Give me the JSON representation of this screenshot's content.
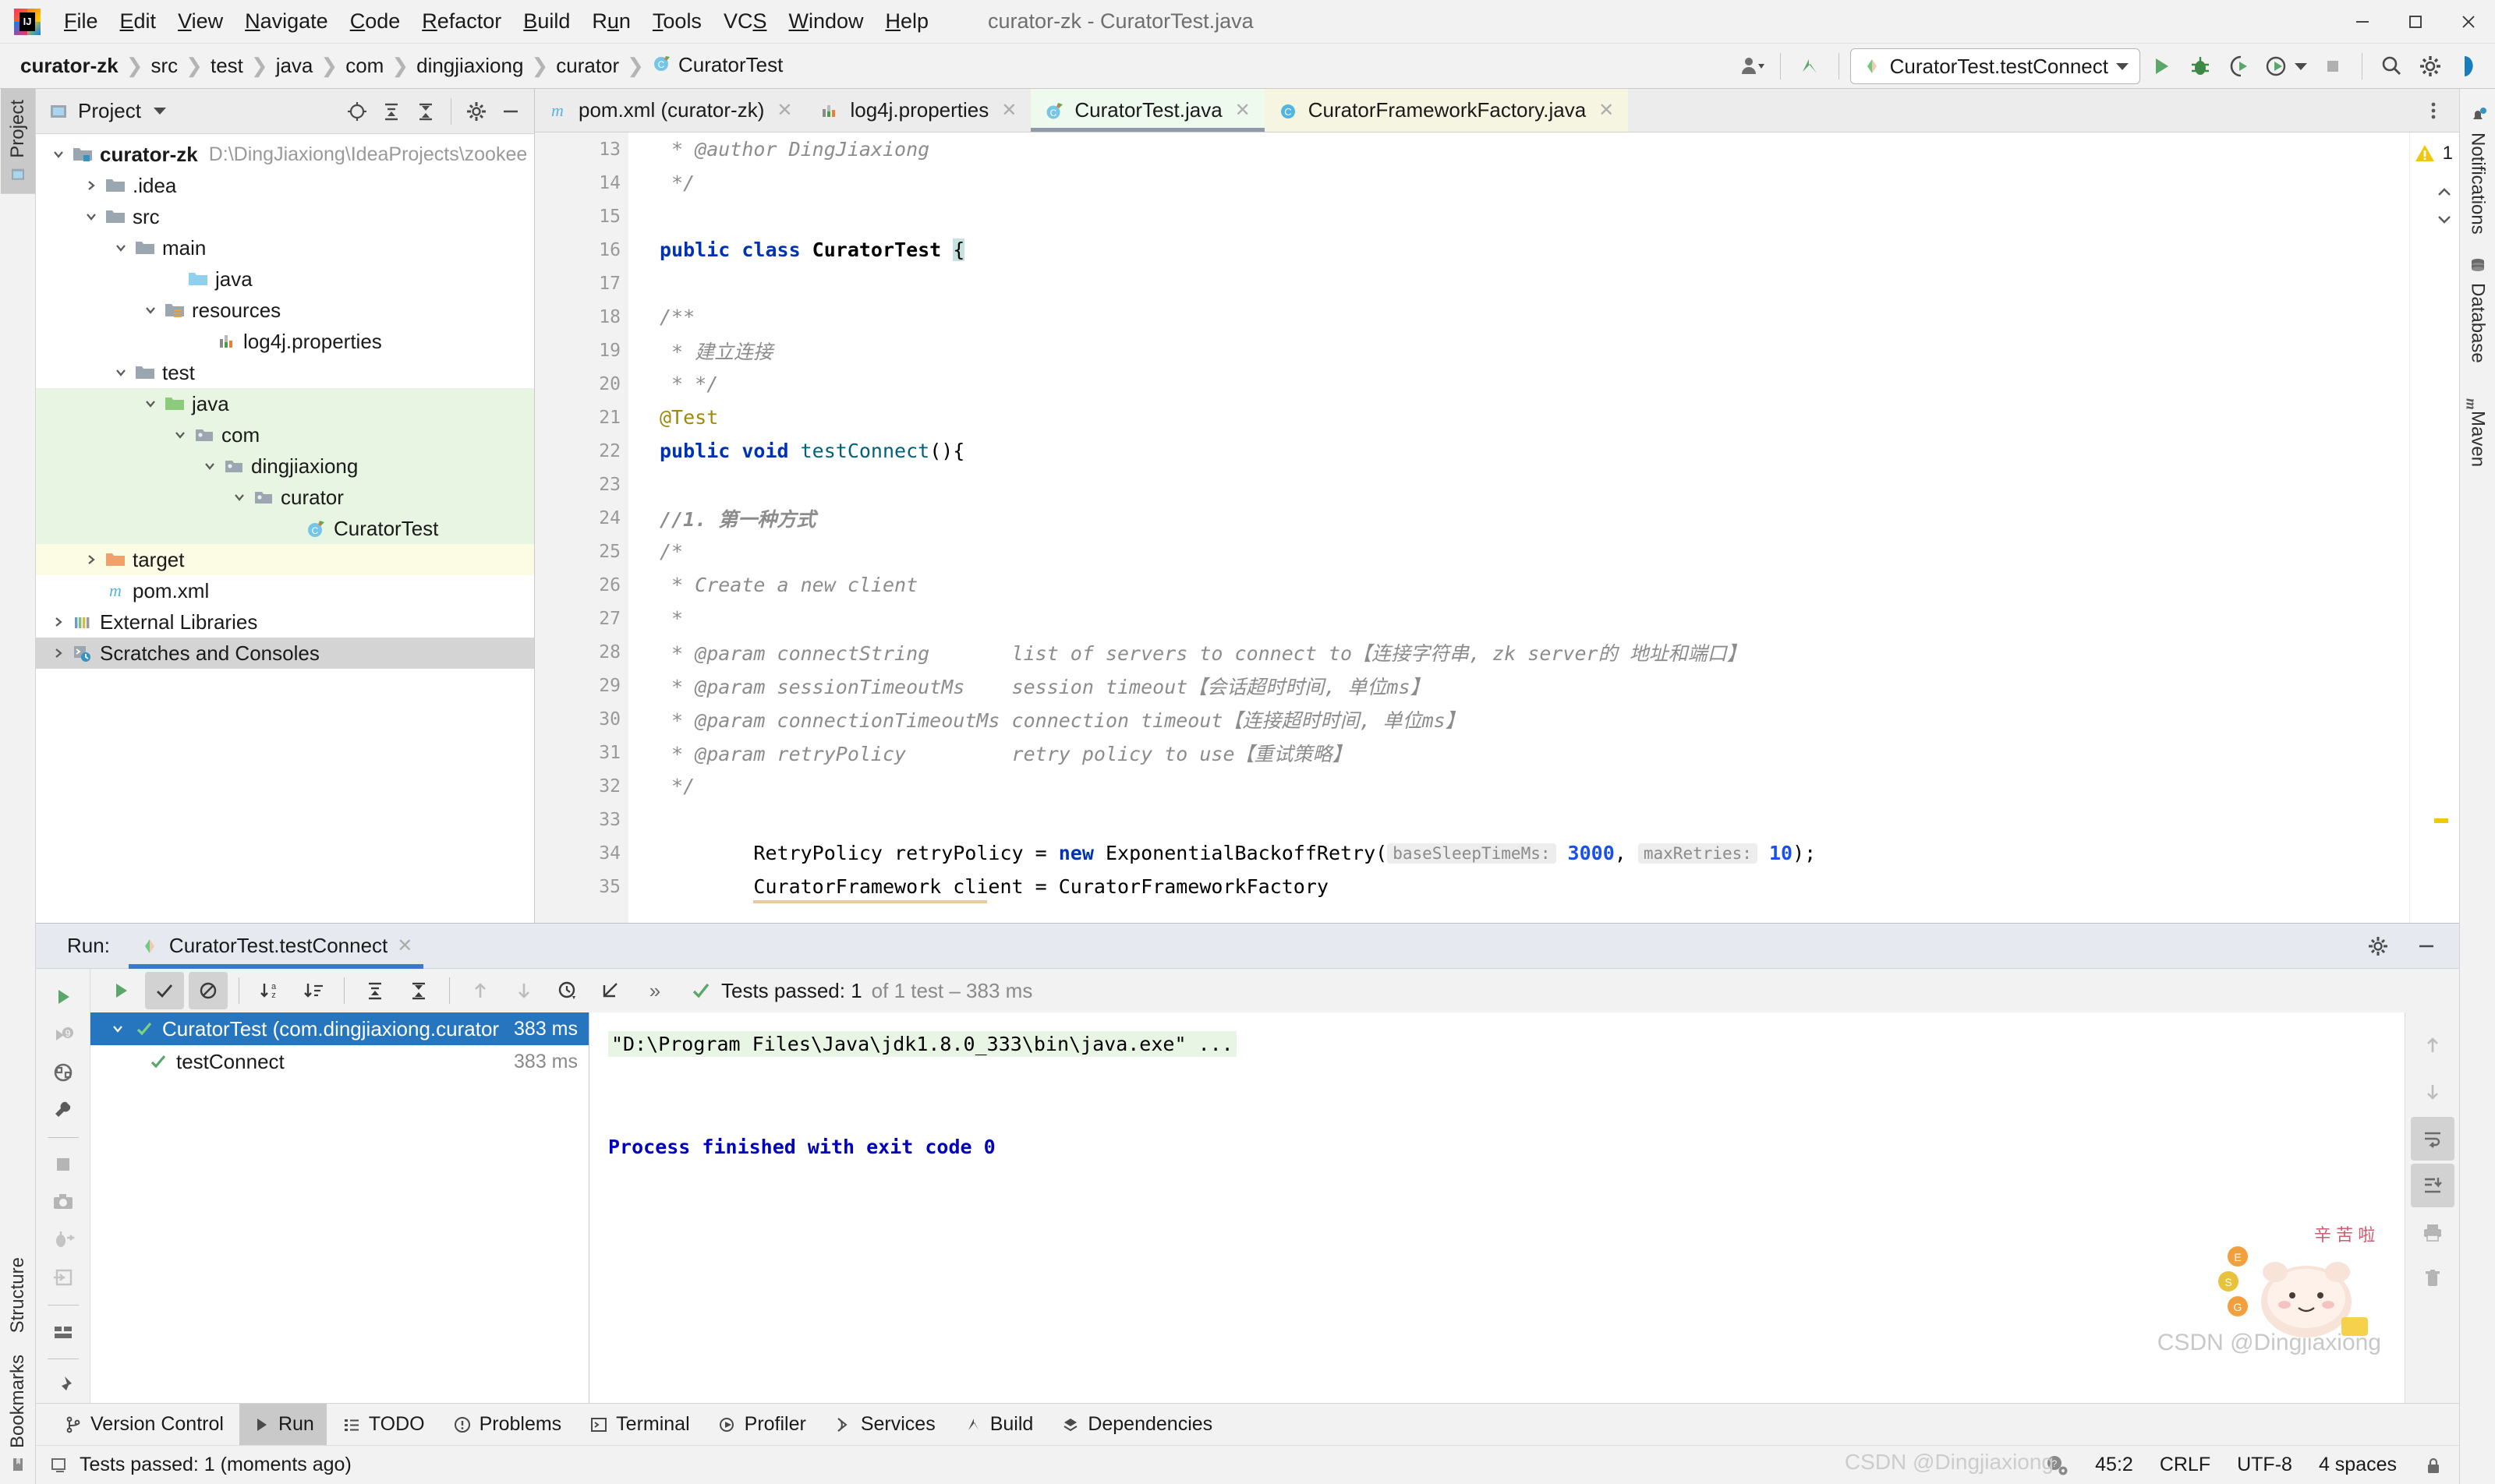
{
  "window": {
    "title": "curator-zk - CuratorTest.java",
    "controls": {
      "minimize": "minimize-icon",
      "maximize": "maximize-icon",
      "close": "close-icon"
    }
  },
  "menu": {
    "items": [
      {
        "label": "File",
        "accel": "F"
      },
      {
        "label": "Edit",
        "accel": "E"
      },
      {
        "label": "View",
        "accel": "V"
      },
      {
        "label": "Navigate",
        "accel": "N"
      },
      {
        "label": "Code",
        "accel": "C"
      },
      {
        "label": "Refactor",
        "accel": "R"
      },
      {
        "label": "Build",
        "accel": "B"
      },
      {
        "label": "Run",
        "accel": "u"
      },
      {
        "label": "Tools",
        "accel": "T"
      },
      {
        "label": "VCS",
        "accel": "S"
      },
      {
        "label": "Window",
        "accel": "W"
      },
      {
        "label": "Help",
        "accel": "H"
      }
    ]
  },
  "navbar": {
    "breadcrumbs": [
      "curator-zk",
      "src",
      "test",
      "java",
      "com",
      "dingjiaxiong",
      "curator",
      "CuratorTest"
    ],
    "run_config": "CuratorTest.testConnect",
    "buttons": [
      "user-icon",
      "updates-icon",
      "run-button",
      "debug-button",
      "run-with-coverage-button",
      "profiler-button",
      "stop-button",
      "search-button",
      "settings-button"
    ]
  },
  "left_strip": {
    "items": [
      "Project",
      "Structure",
      "Bookmarks"
    ],
    "active": "Project"
  },
  "right_strip": {
    "items": [
      "Notifications",
      "Database",
      "Maven"
    ]
  },
  "project_tool_window": {
    "title": "Project",
    "header_icons": [
      "locate-icon",
      "expand-all-icon",
      "collapse-all-icon",
      "settings-icon",
      "hide-icon"
    ],
    "tree": [
      {
        "label": "curator-zk",
        "path": "D:\\DingJiaxiong\\IdeaProjects\\zookee",
        "depth": 0,
        "arrow": "down",
        "icon": "module-folder",
        "bold": true,
        "bg": "none"
      },
      {
        "label": ".idea",
        "depth": 1,
        "arrow": "right",
        "icon": "folder-grey",
        "bg": "none"
      },
      {
        "label": "src",
        "depth": 1,
        "arrow": "down",
        "icon": "folder-grey",
        "bg": "none"
      },
      {
        "label": "main",
        "depth": 2,
        "arrow": "down",
        "icon": "folder-grey",
        "bg": "none"
      },
      {
        "label": "java",
        "depth": 3,
        "arrow": "none",
        "icon": "folder-blue",
        "bg": "none"
      },
      {
        "label": "resources",
        "depth": 3,
        "arrow": "down",
        "icon": "folder-resources",
        "bg": "none"
      },
      {
        "label": "log4j.properties",
        "depth": 4,
        "arrow": "none",
        "icon": "properties-file",
        "bg": "none"
      },
      {
        "label": "test",
        "depth": 2,
        "arrow": "down",
        "icon": "folder-grey",
        "bg": "none"
      },
      {
        "label": "java",
        "depth": 3,
        "arrow": "down",
        "icon": "folder-green",
        "bg": "green"
      },
      {
        "label": "com",
        "depth": 4,
        "arrow": "down",
        "icon": "package",
        "bg": "green"
      },
      {
        "label": "dingjiaxiong",
        "depth": 5,
        "arrow": "down",
        "icon": "package",
        "bg": "green"
      },
      {
        "label": "curator",
        "depth": 6,
        "arrow": "down",
        "icon": "package",
        "bg": "green"
      },
      {
        "label": "CuratorTest",
        "depth": 7,
        "arrow": "none",
        "icon": "test-class",
        "bg": "green"
      },
      {
        "label": "target",
        "depth": 1,
        "arrow": "right",
        "icon": "folder-orange",
        "bg": "yellow"
      },
      {
        "label": "pom.xml",
        "depth": 1,
        "arrow": "none",
        "icon": "maven-file",
        "bg": "none"
      },
      {
        "label": "External Libraries",
        "depth": 0,
        "arrow": "right",
        "icon": "libraries",
        "bg": "none"
      },
      {
        "label": "Scratches and Consoles",
        "depth": 0,
        "arrow": "right",
        "icon": "scratches",
        "bg": "grey"
      }
    ]
  },
  "editor": {
    "tabs": [
      {
        "label": "pom.xml (curator-zk)",
        "icon": "maven-file",
        "state": "inactive"
      },
      {
        "label": "log4j.properties",
        "icon": "properties-file",
        "state": "inactive"
      },
      {
        "label": "CuratorTest.java",
        "icon": "test-class",
        "state": "active-green"
      },
      {
        "label": "CuratorFrameworkFactory.java",
        "icon": "java-class",
        "state": "active-yellow"
      }
    ],
    "warning_count": "1",
    "lines": [
      {
        "n": "13",
        "indent": 0,
        "segments": [
          {
            "t": "cmt",
            "v": " * @author DingJiaxiong"
          }
        ]
      },
      {
        "n": "14",
        "indent": 0,
        "fold": "end",
        "segments": [
          {
            "t": "cmt",
            "v": " */"
          }
        ]
      },
      {
        "n": "15",
        "indent": 0,
        "segments": []
      },
      {
        "n": "16",
        "indent": 0,
        "gmark": "run-test-gutter",
        "segments": [
          {
            "t": "kw",
            "v": "public class "
          },
          {
            "t": "cls",
            "v": "CuratorTest "
          },
          {
            "t": "cursor",
            "v": "{"
          }
        ]
      },
      {
        "n": "17",
        "indent": 0,
        "segments": []
      },
      {
        "n": "18",
        "indent": 1,
        "fold": "start",
        "segments": [
          {
            "t": "cmt",
            "v": "/**"
          }
        ]
      },
      {
        "n": "19",
        "indent": 1,
        "segments": [
          {
            "t": "cmt",
            "v": " * 建立连接"
          }
        ]
      },
      {
        "n": "20",
        "indent": 1,
        "fold": "end",
        "segments": [
          {
            "t": "cmt",
            "v": " * */"
          }
        ]
      },
      {
        "n": "21",
        "indent": 1,
        "segments": [
          {
            "t": "ann",
            "v": "@Test"
          }
        ]
      },
      {
        "n": "22",
        "indent": 1,
        "gmark": "run-test-gutter",
        "fold": "start",
        "segments": [
          {
            "t": "kw",
            "v": "public void "
          },
          {
            "t": "fn",
            "v": "testConnect"
          },
          {
            "t": "plain",
            "v": "(){"
          }
        ]
      },
      {
        "n": "23",
        "indent": 1,
        "segments": []
      },
      {
        "n": "24",
        "indent": 2,
        "segments": [
          {
            "t": "cmt-b",
            "v": "//1. 第一种方式"
          }
        ]
      },
      {
        "n": "25",
        "indent": 2,
        "fold": "start",
        "segments": [
          {
            "t": "cmt",
            "v": "/*"
          }
        ]
      },
      {
        "n": "26",
        "indent": 2,
        "segments": [
          {
            "t": "cmt",
            "v": " * Create a new client"
          }
        ]
      },
      {
        "n": "27",
        "indent": 2,
        "segments": [
          {
            "t": "cmt",
            "v": " *"
          }
        ]
      },
      {
        "n": "28",
        "indent": 2,
        "segments": [
          {
            "t": "cmt",
            "v": " * @param connectString       list of servers to connect to【连接字符串, zk server的 地址和端口】"
          }
        ]
      },
      {
        "n": "29",
        "indent": 2,
        "segments": [
          {
            "t": "cmt",
            "v": " * @param sessionTimeoutMs    session timeout【会话超时时间, 单位ms】"
          }
        ]
      },
      {
        "n": "30",
        "indent": 2,
        "segments": [
          {
            "t": "cmt",
            "v": " * @param connectionTimeoutMs connection timeout【连接超时时间, 单位ms】"
          }
        ]
      },
      {
        "n": "31",
        "indent": 2,
        "segments": [
          {
            "t": "cmt",
            "v": " * @param retryPolicy         retry policy to use【重试策略】"
          }
        ]
      },
      {
        "n": "32",
        "indent": 2,
        "fold": "end",
        "segments": [
          {
            "t": "cmt",
            "v": " */"
          }
        ]
      },
      {
        "n": "33",
        "indent": 2,
        "segments": []
      },
      {
        "n": "34",
        "indent": 2,
        "segments": [
          {
            "t": "plain",
            "v": "RetryPolicy retryPolicy = "
          },
          {
            "t": "kw",
            "v": "new "
          },
          {
            "t": "plain",
            "v": "ExponentialBackoffRetry("
          },
          {
            "t": "hint",
            "v": "baseSleepTimeMs:"
          },
          {
            "t": "num",
            "v": " 3000"
          },
          {
            "t": "plain",
            "v": ", "
          },
          {
            "t": "hint",
            "v": "maxRetries:"
          },
          {
            "t": "num",
            "v": " 10"
          },
          {
            "t": "plain",
            "v": ");"
          }
        ]
      },
      {
        "n": "35",
        "indent": 2,
        "segments": [
          {
            "t": "plain",
            "v": "CuratorFramework client = CuratorFrameworkFactory"
          }
        ]
      }
    ]
  },
  "run_tool_window": {
    "label": "Run:",
    "tab": "CuratorTest.testConnect",
    "toolbar_left_icons": [
      "rerun-icon",
      "rerun-failed-icon",
      "rerun-auto-icon",
      "configure-icon",
      "stop-icon",
      "screenshot-icon",
      "dump-threads-icon",
      "export-icon",
      "layout-icon",
      "pin-icon"
    ],
    "toolbar_icons": [
      "rerun-run-icon",
      "show-passed-toggle",
      "show-ignored-toggle",
      "sort-alphabetically-icon",
      "sort-duration-icon",
      "expand-all-icon",
      "collapse-all-icon",
      "prev-failed-icon",
      "next-failed-icon",
      "history-icon",
      "export-results-icon",
      "more-icon"
    ],
    "status": {
      "passed_label": "Tests passed: 1",
      "detail": "of 1 test – 383 ms"
    },
    "tests": [
      {
        "label": "CuratorTest (com.dingjiaxiong.curator",
        "time": "383 ms",
        "selected": true,
        "arrow": "down",
        "status": "passed"
      },
      {
        "label": "testConnect",
        "time": "383 ms",
        "selected": false,
        "arrow": "none",
        "status": "passed"
      }
    ],
    "console": [
      {
        "type": "cmd",
        "text": "\"D:\\Program Files\\Java\\jdk1.8.0_333\\bin\\java.exe\" ..."
      },
      {
        "type": "blank",
        "text": ""
      },
      {
        "type": "blue",
        "text": "Process finished with exit code 0"
      }
    ],
    "console_tools": [
      "scroll-up-icon",
      "scroll-down-icon",
      "soft-wrap-icon",
      "scroll-to-end-icon",
      "print-icon",
      "clear-all-icon"
    ]
  },
  "bottom_tool_windows": [
    {
      "label": "Version Control",
      "icon": "branch-icon",
      "active": false
    },
    {
      "label": "Run",
      "icon": "run-icon",
      "active": true
    },
    {
      "label": "TODO",
      "icon": "todo-icon",
      "active": false
    },
    {
      "label": "Problems",
      "icon": "problems-icon",
      "active": false
    },
    {
      "label": "Terminal",
      "icon": "terminal-icon",
      "active": false
    },
    {
      "label": "Profiler",
      "icon": "profiler-icon",
      "active": false
    },
    {
      "label": "Services",
      "icon": "services-icon",
      "active": false
    },
    {
      "label": "Build",
      "icon": "build-icon",
      "active": false
    },
    {
      "label": "Dependencies",
      "icon": "dependencies-icon",
      "active": false
    }
  ],
  "statusbar": {
    "message": "Tests passed: 1 (moments ago)",
    "caret": "45:2",
    "line_separator": "CRLF",
    "encoding": "UTF-8",
    "indent": "4 spaces"
  },
  "watermark": "CSDN @Dingjiaxiong"
}
